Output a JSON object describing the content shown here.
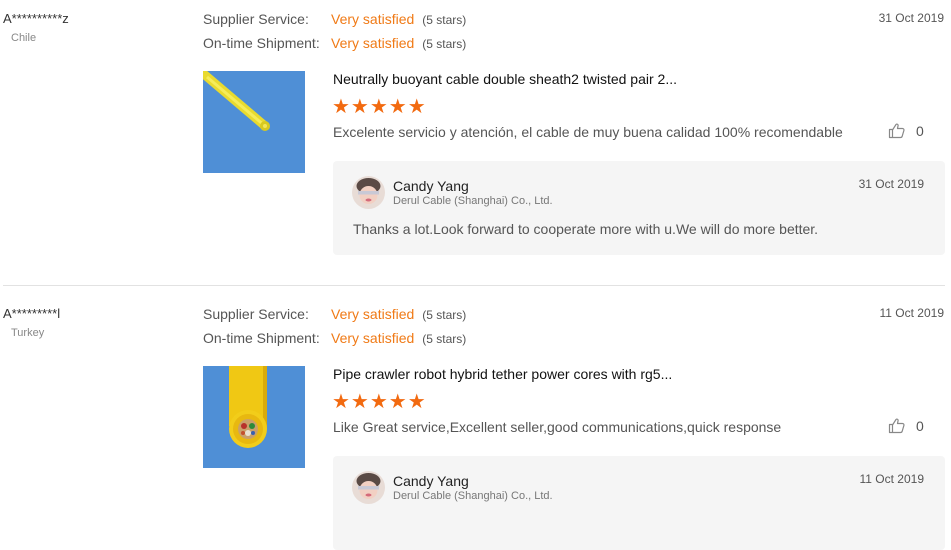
{
  "reviews": [
    {
      "buyer": "A**********z",
      "country": "Chile",
      "supplier_service_label": "Supplier Service:",
      "supplier_service_value": "Very satisfied",
      "supplier_service_stars": "(5 stars)",
      "shipment_label": "On-time Shipment:",
      "shipment_value": "Very satisfied",
      "shipment_stars": "(5 stars)",
      "date": "31 Oct 2019",
      "product": "Neutrally buoyant cable double sheath2 twisted pair 2...",
      "rating_stars": "★★★★★",
      "rating": 5,
      "comment": "Excelente servicio y atención, el cable de muy buena calidad 100% recomendable",
      "likes": "0",
      "reply": {
        "name": "Candy Yang",
        "company": "Derul Cable (Shanghai) Co., Ltd.",
        "date": "31 Oct 2019",
        "text": "Thanks a lot.Look forward to cooperate more with u.We will do more better."
      }
    },
    {
      "buyer": "A*********l",
      "country": "Turkey",
      "supplier_service_label": "Supplier Service:",
      "supplier_service_value": "Very satisfied",
      "supplier_service_stars": "(5 stars)",
      "shipment_label": "On-time Shipment:",
      "shipment_value": "Very satisfied",
      "shipment_stars": "(5 stars)",
      "date": "11 Oct 2019",
      "product": "Pipe crawler robot hybrid tether power cores with rg5...",
      "rating_stars": "★★★★★",
      "rating": 5,
      "comment": "Like Great service,Excellent seller,good communications,quick response",
      "likes": "0",
      "reply": {
        "name": "Candy Yang",
        "company": "Derul Cable (Shanghai) Co., Ltd.",
        "date": "11 Oct 2019",
        "text": ""
      }
    }
  ],
  "colors": {
    "accent": "#f07a16",
    "star": "#f26a10",
    "reply_bg": "#f5f5f5",
    "thumb_bg": "#4f8fd6"
  },
  "icons": {
    "like": "thumbs-up-icon",
    "avatar": "avatar"
  }
}
